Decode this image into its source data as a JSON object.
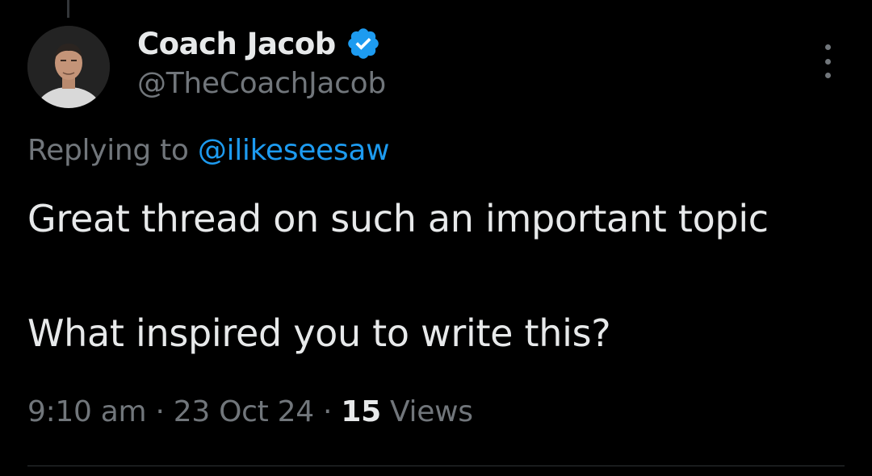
{
  "tweet": {
    "author": {
      "display_name": "Coach Jacob",
      "handle": "@TheCoachJacob",
      "verified": true,
      "avatar_icon": "profile-photo"
    },
    "replying_prefix": "Replying to",
    "replying_to": "@ilikeseesaw",
    "text_lines": [
      "Great thread on such an important topic",
      "What inspired you to write this?"
    ],
    "meta": {
      "time": "9:10 am",
      "separator": "·",
      "date": "23 Oct 24",
      "views_count": "15",
      "views_label": "Views"
    },
    "more_icon": "more-options-vertical-icon"
  },
  "colors": {
    "background": "#000000",
    "primary_text": "#e7e9ea",
    "secondary_text": "#71767b",
    "link": "#1d9bf0",
    "verified_badge": "#1d9bf0",
    "divider": "#2f3336"
  }
}
